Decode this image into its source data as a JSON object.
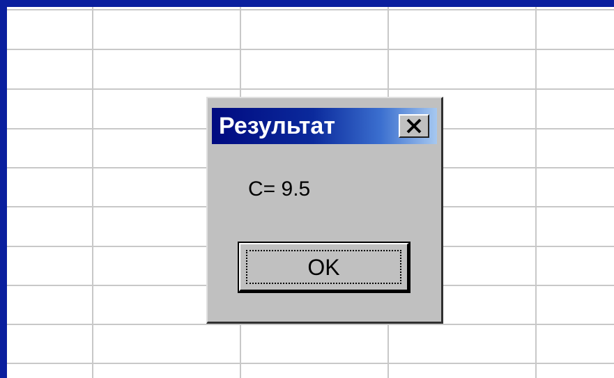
{
  "dialog": {
    "title": "Результат",
    "message": "C= 9.5",
    "ok_label": "OK",
    "close_icon": "close-icon"
  },
  "colors": {
    "frame": "#0a1f9e",
    "dialog_bg": "#c0c0c0",
    "title_gradient_start": "#000a80",
    "title_gradient_end": "#a6c8f0",
    "grid_line": "#c8c8c8"
  }
}
